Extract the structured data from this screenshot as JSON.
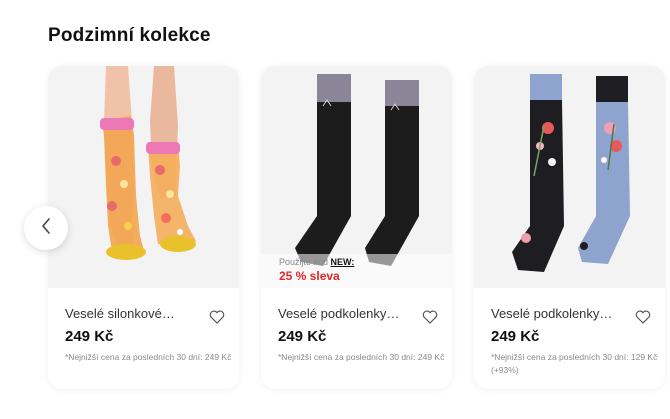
{
  "section": {
    "title": "Podzimní kolekce"
  },
  "products": [
    {
      "name": "Veselé silonkové…",
      "price": "249 Kč",
      "lowest_price": "*Nejnižší cena za posledních 30 dní: 249 Kč",
      "image_icon": "floral-sheer-socks-image",
      "favorite_icon": "heart-icon"
    },
    {
      "name": "Veselé podkolenky…",
      "price": "249 Kč",
      "lowest_price": "*Nejnižší cena za posledních 30 dní: 249 Kč",
      "image_icon": "black-cat-knee-socks-image",
      "favorite_icon": "heart-icon",
      "promo": {
        "prefix": "Použijte kód ",
        "code": "NEW:",
        "discount": "25 % sleva"
      }
    },
    {
      "name": "Veselé podkolenky…",
      "price": "249 Kč",
      "lowest_price": "*Nejnižší cena za posledních 30 dní: 129 Kč (+93%)",
      "image_icon": "floral-odd-knee-socks-image",
      "favorite_icon": "heart-icon"
    }
  ],
  "carousel": {
    "prev_icon": "chevron-left-icon"
  },
  "colors": {
    "discount": "#e4282a",
    "promo_code": "#111111"
  }
}
